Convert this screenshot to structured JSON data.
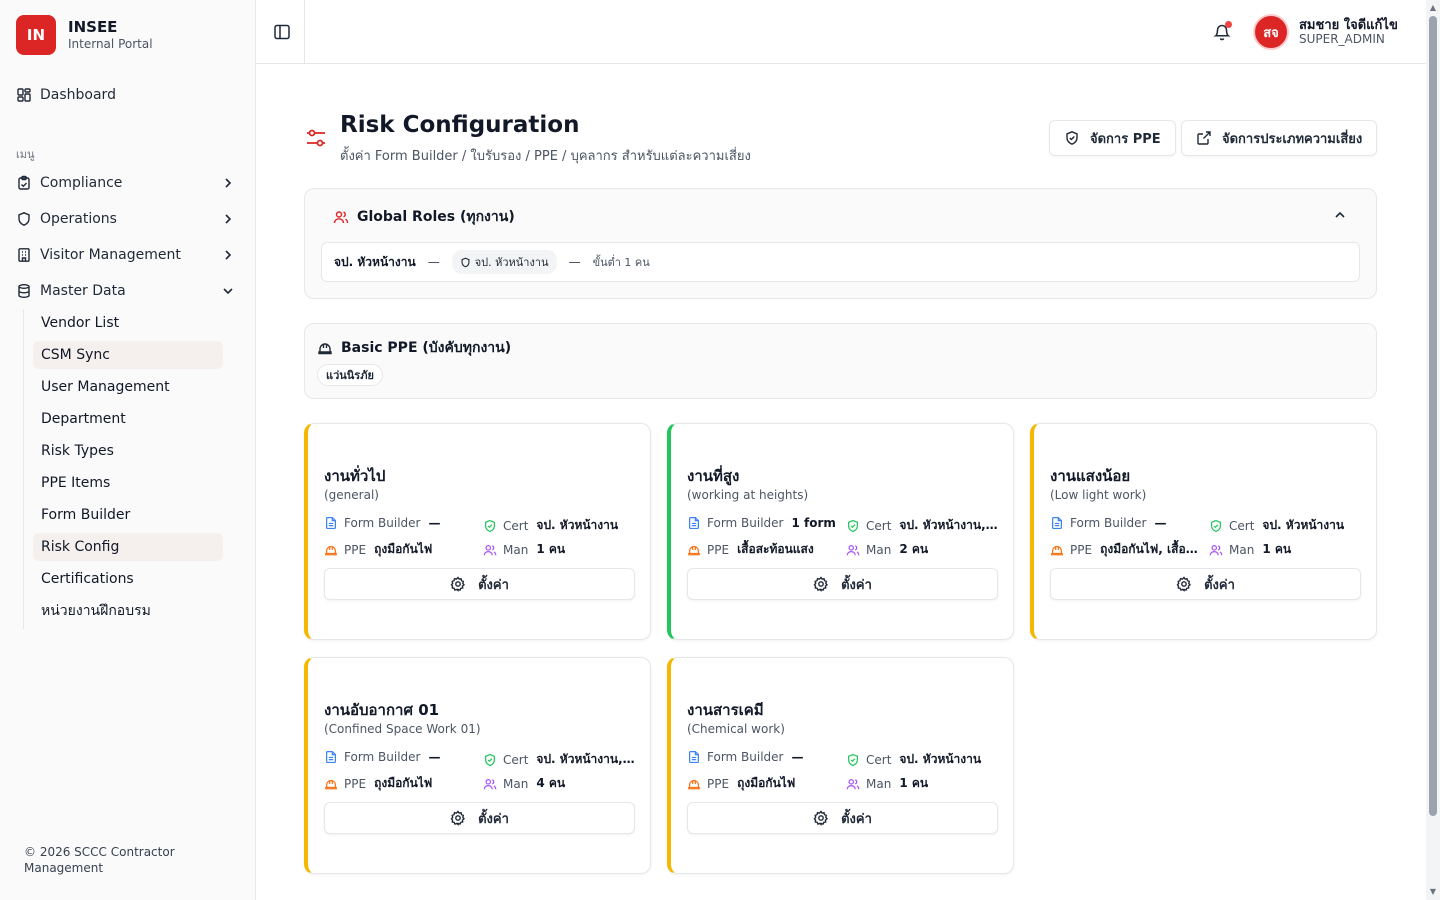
{
  "brand": {
    "logo": "IN",
    "name": "INSEE",
    "subtitle": "Internal Portal"
  },
  "sidebar": {
    "dashboard": "Dashboard",
    "section_label": "เมนู",
    "groups": [
      {
        "label": "Compliance",
        "icon": "clipboard-check-icon"
      },
      {
        "label": "Operations",
        "icon": "shield-icon"
      },
      {
        "label": "Visitor Management",
        "icon": "building-icon"
      },
      {
        "label": "Master Data",
        "icon": "database-icon"
      }
    ],
    "master_items": [
      "Vendor List",
      "CSM Sync",
      "User Management",
      "Department",
      "Risk Types",
      "PPE Items",
      "Form Builder",
      "Risk Config",
      "Certifications",
      "หน่วยงานฝึกอบรม"
    ],
    "copyright": "© 2026 SCCC Contractor Management"
  },
  "topbar": {
    "user_initials": "สจ",
    "user_name": "สมชาย ใจดีแก้ไข",
    "user_role": "SUPER_ADMIN"
  },
  "page": {
    "title": "Risk Configuration",
    "subtitle": "ตั้งค่า Form Builder / ใบรับรอง / PPE / บุคลากร สำหรับแต่ละความเสี่ยง",
    "btn_ppe": "จัดการ PPE",
    "btn_risk_types": "จัดการประเภทความเสี่ยง"
  },
  "global_roles": {
    "title": "Global Roles (ทุกงาน)",
    "role_name": "จป. หัวหน้างาน",
    "dash": "—",
    "badge": "จป. หัวหน้างาน",
    "min": "ขั้นต่ำ 1 คน"
  },
  "basic_ppe": {
    "title": "Basic PPE (บังคับทุกงาน)",
    "tag": "แว่นนิรภัย"
  },
  "labels": {
    "form_builder": "Form Builder",
    "cert": "Cert",
    "ppe": "PPE",
    "man": "Man",
    "configure": "ตั้งค่า"
  },
  "colors": {
    "accent": "#dc2626",
    "yellow": "#f5b800",
    "green": "#22c55e"
  },
  "risks": [
    {
      "name": "งานทั่วไป",
      "code": "(general)",
      "form": "—",
      "cert": "จป. หัวหน้างาน",
      "ppe": "ถุงมือกันไฟ",
      "man": "1 คน"
    },
    {
      "name": "งานที่สูง",
      "code": "(working at heights)",
      "form": "1 form",
      "cert": "จป. หัวหน้างาน, ทำ...",
      "ppe": "เสื้อสะท้อนแสง",
      "man": "2 คน"
    },
    {
      "name": "งานแสงน้อย",
      "code": "(Low light work)",
      "form": "—",
      "cert": "จป. หัวหน้างาน",
      "ppe": "ถุงมือกันไฟ, เสื้อสะ...",
      "man": "1 คน"
    },
    {
      "name": "งานอับอากาศ 01",
      "code": "(Confined Space Work 01)",
      "form": "—",
      "cert": "จป. หัวหน้างาน, C...",
      "ppe": "ถุงมือกันไฟ",
      "man": "4 คน"
    },
    {
      "name": "งานสารเคมี",
      "code": "(Chemical work)",
      "form": "—",
      "cert": "จป. หัวหน้างาน",
      "ppe": "ถุงมือกันไฟ",
      "man": "1 คน"
    }
  ]
}
